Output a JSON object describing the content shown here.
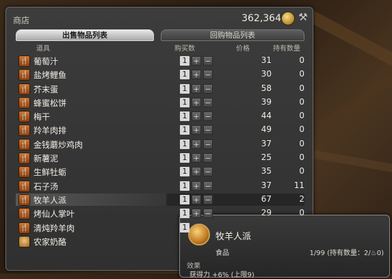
{
  "window": {
    "title": "商店",
    "gil": "362,364"
  },
  "tabs": [
    {
      "label": "出售物品列表",
      "active": true
    },
    {
      "label": "回购物品列表",
      "active": false
    }
  ],
  "headers": {
    "item": "道具",
    "qty": "购买数",
    "price": "价格",
    "owned": "持有数量"
  },
  "items": [
    {
      "name": "葡萄汁",
      "qty": "1",
      "price": "31",
      "owned": "0"
    },
    {
      "name": "盐烤鲤鱼",
      "qty": "1",
      "price": "30",
      "owned": "0"
    },
    {
      "name": "芥末蛋",
      "qty": "1",
      "price": "58",
      "owned": "0"
    },
    {
      "name": "蜂蜜松饼",
      "qty": "1",
      "price": "39",
      "owned": "0"
    },
    {
      "name": "梅干",
      "qty": "1",
      "price": "44",
      "owned": "0"
    },
    {
      "name": "羚羊肉排",
      "qty": "1",
      "price": "49",
      "owned": "0"
    },
    {
      "name": "金钱蘑炒鸡肉",
      "qty": "1",
      "price": "37",
      "owned": "0"
    },
    {
      "name": "新薯泥",
      "qty": "1",
      "price": "25",
      "owned": "0"
    },
    {
      "name": "生鲜牡蛎",
      "qty": "1",
      "price": "35",
      "owned": "0"
    },
    {
      "name": "石子汤",
      "qty": "1",
      "price": "37",
      "owned": "11"
    },
    {
      "name": "牧羊人派",
      "qty": "1",
      "price": "67",
      "owned": "2"
    },
    {
      "name": "烤仙人掌叶",
      "qty": "1",
      "price": "29",
      "owned": "0"
    },
    {
      "name": "清炖羚羊肉",
      "qty": "1",
      "price": "",
      "owned": ""
    },
    {
      "name": "农家奶酪",
      "qty": "",
      "price": "",
      "owned": ""
    }
  ],
  "tooltip": {
    "name": "牧羊人派",
    "category": "食品",
    "stack": "1/99 (持有数量：2/",
    "stack_hq": "0)",
    "effect_label": "效果",
    "effect_line": "获得力 +6% (上限9)"
  },
  "icons": {
    "food": "utensils-icon",
    "dairy": "cheese-icon",
    "gil": "coin-icon",
    "tools": "tools-icon"
  }
}
